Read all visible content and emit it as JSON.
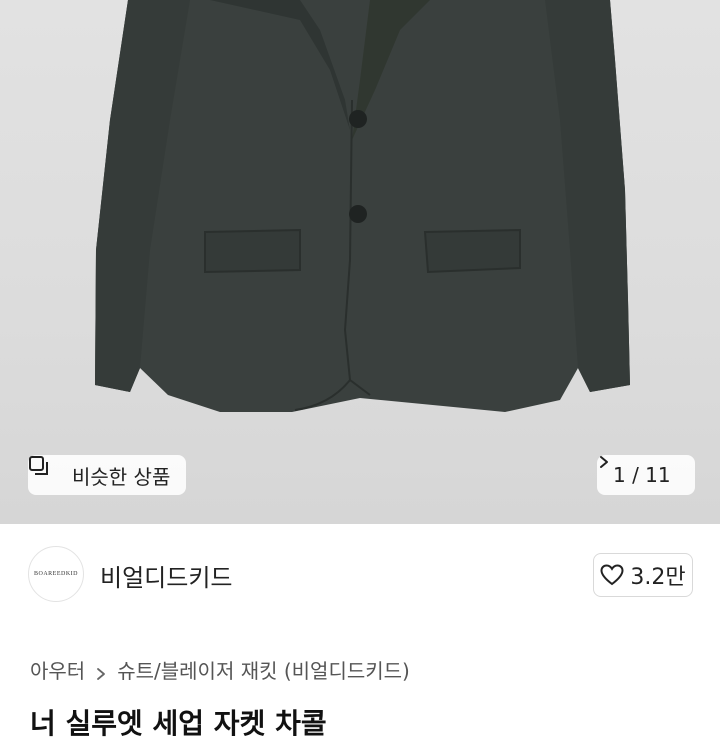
{
  "gallery": {
    "similar_label": "비슷한 상품",
    "counter": "1 / 11"
  },
  "seller": {
    "avatar_text": "BOAREEDKID",
    "name": "비얼디드키드",
    "likes": "3.2만"
  },
  "breadcrumb": {
    "items": [
      "아우터",
      "슈트/블레이저 재킷 (비얼디드키드)"
    ]
  },
  "product": {
    "title": "너 실루엣 세업 자켓 차콜"
  },
  "icons": {
    "similar": "similar-items-icon",
    "next": "chevron-right-icon",
    "like": "heart-outline-icon",
    "separator": "chevron-right-icon"
  },
  "colors": {
    "jacket": "#3a403e",
    "background": "#dcdcdc"
  }
}
